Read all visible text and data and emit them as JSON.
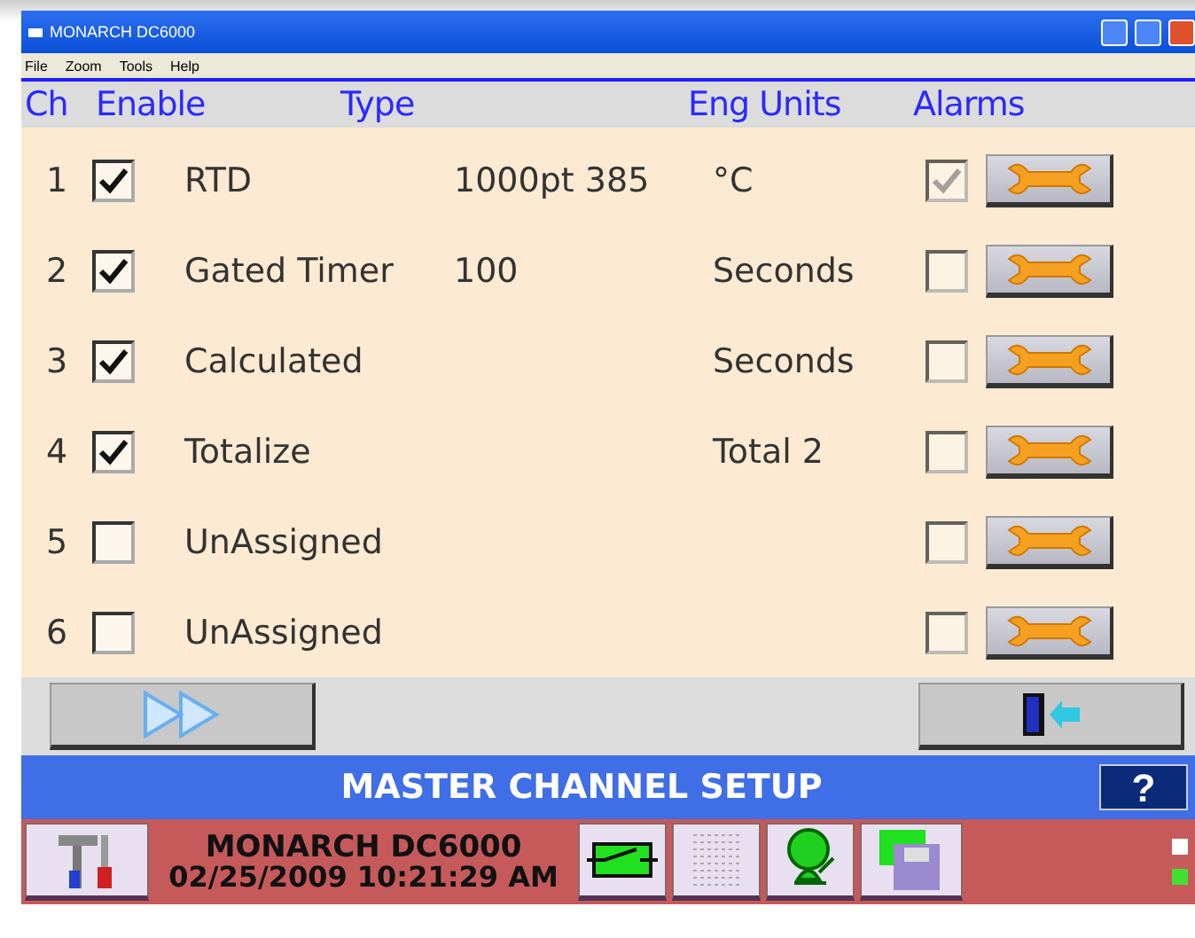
{
  "window": {
    "title": "MONARCH DC6000"
  },
  "menu": [
    "File",
    "Zoom",
    "Tools",
    "Help"
  ],
  "columns": [
    "Ch",
    "Enable",
    "Type",
    "Eng Units",
    "Alarms"
  ],
  "channels": [
    {
      "ch": "1",
      "enabled": true,
      "type": "RTD",
      "detail": "1000pt 385",
      "units": "°C",
      "alarm": true
    },
    {
      "ch": "2",
      "enabled": true,
      "type": "Gated Timer",
      "detail": "100",
      "units": "Seconds",
      "alarm": false
    },
    {
      "ch": "3",
      "enabled": true,
      "type": "Calculated",
      "units": "Seconds",
      "alarm": false
    },
    {
      "ch": "4",
      "enabled": true,
      "type": "Totalize",
      "units": "Total 2",
      "alarm": false
    },
    {
      "ch": "5",
      "enabled": false,
      "type": "UnAssigned",
      "alarm": false
    },
    {
      "ch": "6",
      "enabled": false,
      "type": "UnAssigned",
      "alarm": false
    }
  ],
  "screen_title": "MASTER CHANNEL SETUP",
  "help": "?",
  "status": {
    "device": "MONARCH DC6000",
    "datetime": "02/25/2009 10:21:29 AM"
  }
}
